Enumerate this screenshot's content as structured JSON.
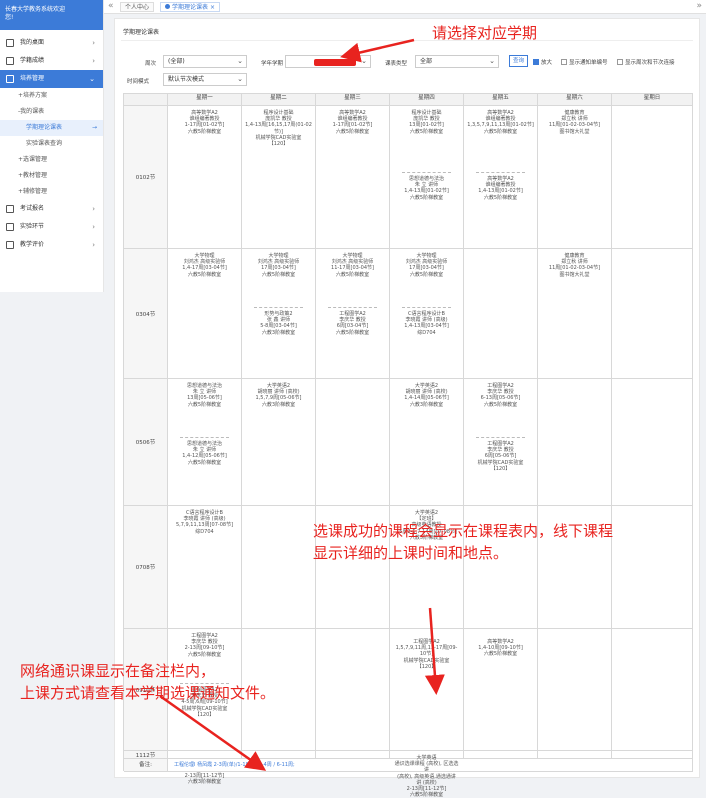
{
  "sidebar": {
    "header_line1": "长春大学教务系统欢迎",
    "header_line2": "您!",
    "items": [
      {
        "label": "我的桌面"
      },
      {
        "label": "学籍成绩"
      },
      {
        "label": "培养管理"
      },
      {
        "label": "考试报名"
      },
      {
        "label": "实验环节"
      },
      {
        "label": "教学评价"
      }
    ],
    "sub": {
      "plan": "培养方案",
      "my_courses": "我的课表",
      "term_timetable": "学期理论课表",
      "lab_timetable": "实验课表查询",
      "course_select": "选课管理",
      "textbook": "教材管理",
      "supplementary": "辅修管理"
    }
  },
  "topbar": {
    "left_arrow": "«",
    "right_arrow": "»",
    "tabs": [
      {
        "label": "个人中心"
      },
      {
        "label": "学期理论课表"
      }
    ]
  },
  "panel": {
    "title": "学期理论课表",
    "filters": {
      "week_label": "周次",
      "week_value": "(全部)",
      "term_label": "学年学期",
      "type_label": "课表类型",
      "type_value": "全部",
      "time_label": "时间模式",
      "time_value": "默认节次模式"
    },
    "query_button": "查询",
    "checkbox_enlarge": "放大",
    "checkbox_show_notice": "显示通知单编号",
    "checkbox_show_week": "显示周次和节次连接"
  },
  "timetable": {
    "days": [
      "星期一",
      "星期二",
      "星期三",
      "星期四",
      "星期五",
      "星期六",
      "星期日"
    ],
    "periods": [
      "0102节",
      "0304节",
      "0506节",
      "0708节",
      "0910节",
      "1112节"
    ],
    "note_label": "备注:",
    "note_text": "工程伦理I 杨凤霞 2-3周(单)/1-18周 / 1-4周 / 6-11周;",
    "courses": {
      "p1_mon": [
        "高等数学A2",
        "谁组编著教授",
        "1-17周[01-02节]",
        "六教5阶梯教室"
      ],
      "p1_tue": [
        "程序设计基础",
        "庞凯华 教授",
        "1,4-13周[16,15,17周(01-02节)]",
        "机械学院CAD实验室",
        "【120】"
      ],
      "p1_wed": [
        "高等数学A2",
        "谁组编著教授",
        "1-17周[01-02节]",
        "六教5阶梯教室"
      ],
      "p1_thu_a": [
        "程序设计基础",
        "庞凯华 教授",
        "13周[01-02节]",
        "六教5阶梯教室"
      ],
      "p1_thu_b": [
        "思想道德与法治",
        "朱 立 讲师",
        "1,4-13周[01-02节]",
        "六教5阶梯教室"
      ],
      "p1_fri_a": [
        "高等数学A2",
        "谁组编著教授",
        "1,3,5,7,9,11,13周[01-02节]",
        "六教5阶梯教室"
      ],
      "p1_fri_b": [
        "高等数学A2",
        "谁组编著教授",
        "1,4-13周[01-02节]",
        "六教5阶梯教室"
      ],
      "p1_sat": [
        "健康教育",
        "郑立秋 讲师",
        "11周[01-02-03-04节]",
        "图书馆大礼堂"
      ],
      "p2_mon": [
        "大学物理",
        "刘鸿杰 高级实验师",
        "1,4-17周[03-04节]",
        "六教5阶梯教室"
      ],
      "p2_tue_a": [
        "大学物理",
        "刘鸿杰 高级实验师",
        "17周[03-04节]",
        "六教5阶梯教室"
      ],
      "p2_tue_b": [
        "形势与政策2",
        "张 鑫 讲师",
        "5-8周[03-04节]",
        "六教3阶梯教室"
      ],
      "p2_wed_a": [
        "大学物理",
        "刘鸿杰 高级实验师",
        "11-17周[03-04节]",
        "六教5阶梯教室"
      ],
      "p2_wed_b": [
        "工程图学A2",
        "李庆华 教授",
        "6周[03-04节]",
        "六教5阶梯教室"
      ],
      "p2_thu_a": [
        "大学物理",
        "刘鸿杰 高级实验师",
        "17周[03-04节]",
        "六教5阶梯教室"
      ],
      "p2_thu_b": [
        "C语言程序设计B",
        "李晓霞 讲师 (高级)",
        "1,4-13周[03-04节]",
        "综D704"
      ],
      "p2_sat": [
        "健康教育",
        "郑立秋 讲师",
        "11周[01-02-03-04节]",
        "图书馆大礼堂"
      ],
      "p3_mon_a": [
        "思想道德与法治",
        "朱 立 讲师",
        "13周[05-06节]",
        "六教5阶梯教室"
      ],
      "p3_mon_b": [
        "思想道德与法治",
        "朱 立 讲师",
        "1,4-12周[05-06节]",
        "六教5阶梯教室"
      ],
      "p3_tue": [
        "大学英语2",
        "胡晓丽 讲师 (高校)",
        "1,5,7,9周[05-06节]",
        "六教3阶梯教室"
      ],
      "p3_thu": [
        "大学英语2",
        "胡晓丽 讲师 (高校)",
        "1,4-14周[05-06节]",
        "六教3阶梯教室"
      ],
      "p3_fri_a": [
        "工程图学A2",
        "李庆华 教授",
        "6-13周[05-06节]",
        "六教5阶梯教室"
      ],
      "p3_fri_b": [
        "工程图学A2",
        "李庆华 教授",
        "6周[05-06节]",
        "机械学院CAD实验室",
        "【120】"
      ],
      "p4_mon": [
        "C语言程序设计B",
        "李晓霞 讲师 (高级)",
        "5,7,9,11,13周[07-08节]",
        "综D704"
      ],
      "p4_thu": [
        "大学英语2",
        "【定班】",
        "高级英语教授",
        "15周3-5,7-14周[07-08节]",
        "六教5阶梯教室"
      ],
      "p5_mon_a": [
        "工程图学A2",
        "李庆华 教授",
        "2-13周[09-10节]",
        "六教5阶梯教室"
      ],
      "p5_mon_b": [
        "工程图学A2",
        "李庆华 教授",
        "4-5周,6周[09-10节]",
        "机械学院CAD实验室",
        "【120】"
      ],
      "p5_thu": [
        "工程图学A2",
        "1,5,7,9,11周,13-17周[09-10节]",
        "机械学院CAD实验室",
        "【120】"
      ],
      "p5_fri": [
        "高等数学A2",
        "1,4-10周[09-10节]",
        "六教5阶梯教室"
      ],
      "p6_mon": [
        "2-13周[11-12节]",
        "六教3阶梯教室"
      ],
      "p6_thu": [
        "大学英语",
        "通识选课课程 (高校), 区选选讲",
        "(高校), 高级英语,通选通讲",
        "讲 (高校)",
        "2-13周[11-12节]",
        "六教5阶梯教室"
      ]
    }
  },
  "annotations": {
    "select_term": "请选择对应学期",
    "success_line1": "选课成功的课程会显示在课程表内，线下课程",
    "success_line2": "显示详细的上课时间和地点。",
    "online_line1": "网络通识课显示在备注栏内，",
    "online_line2": "上课方式请查看本学期选课通知文件。"
  },
  "colors": {
    "accent": "#3c7bd8",
    "annotation_red": "#e8231f"
  }
}
